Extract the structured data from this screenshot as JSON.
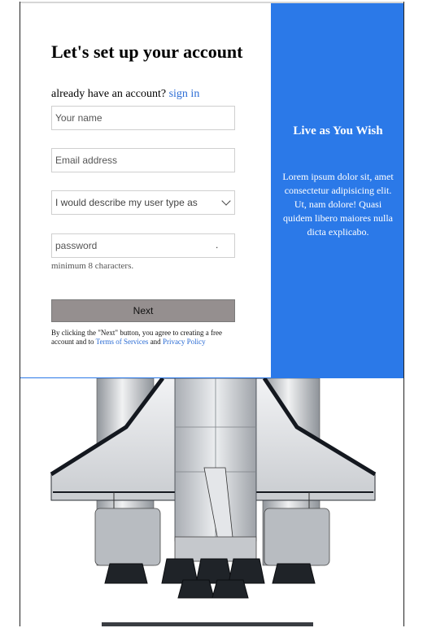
{
  "form": {
    "title": "Let's set up your account",
    "signin_prompt": "already have an account?",
    "signin_link": "sign in",
    "name_placeholder": "Your name",
    "email_placeholder": "Email address",
    "user_type_selected": "I would describe my user type as",
    "password_placeholder": "password",
    "password_hint": "minimum 8 characters.",
    "next_label": "Next",
    "terms_prefix": "By clicking the \"Next\" button, you agree to creating a free account and to",
    "terms_link": "Terms of Services",
    "terms_and": "and",
    "privacy_link": "Privacy Policy"
  },
  "side": {
    "title": "Live as You Wish",
    "body": "Lorem ipsum dolor sit, amet consectetur adipisicing elit. Ut, nam dolore! Quasi quidem libero maiores nulla dicta explicabo."
  },
  "colors": {
    "accent": "#2b79e8",
    "link": "#2b6cd4",
    "button": "#958f8f"
  },
  "image": {
    "subject": "space-shuttle-image"
  }
}
